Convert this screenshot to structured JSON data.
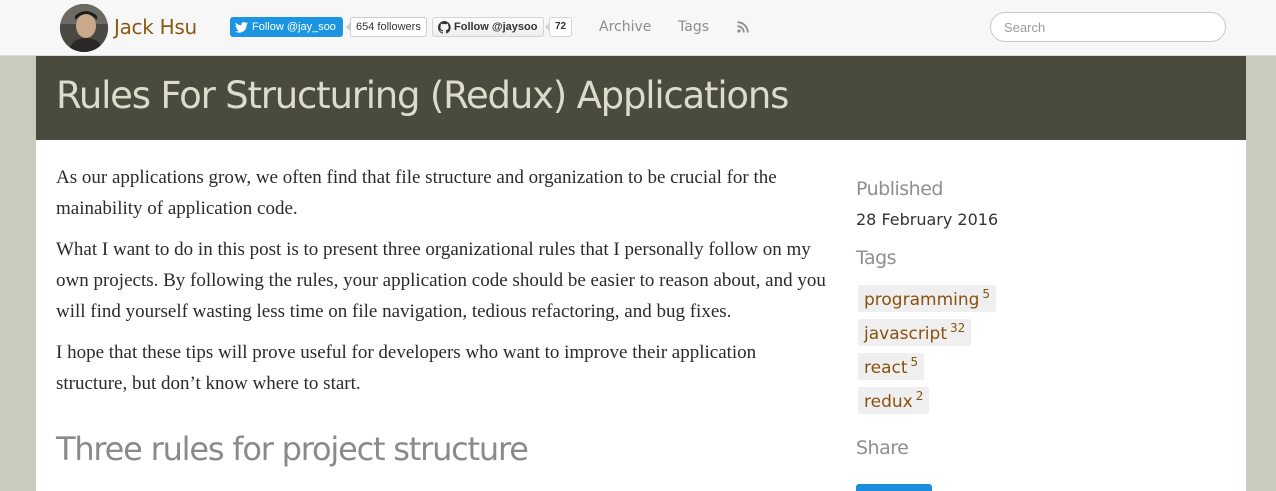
{
  "header": {
    "site_title": "Jack Hsu",
    "twitter_follow": "Follow @jay_soo",
    "twitter_count": "654 followers",
    "github_follow": "Follow @jaysoo",
    "github_count": "72",
    "nav": {
      "archive": "Archive",
      "tags": "Tags"
    },
    "search_placeholder": "Search"
  },
  "post": {
    "title": "Rules For Structuring (Redux) Applications",
    "paragraphs": [
      "As our applications grow, we often find that file structure and organization to be crucial for the mainability of application code.",
      "What I want to do in this post is to present three organizational rules that I personally follow on my own projects. By following the rules, your application code should be easier to reason about, and you will find yourself wasting less time on file navigation, tedious refactoring, and bug fixes.",
      "I hope that these tips will prove useful for developers who want to improve their application structure, but don’t know where to start."
    ],
    "section_heading": "Three rules for project structure"
  },
  "sidebar": {
    "published_heading": "Published",
    "published_date": "28 February 2016",
    "tags_heading": "Tags",
    "tags": [
      {
        "name": "programming",
        "count": "5"
      },
      {
        "name": "javascript",
        "count": "32"
      },
      {
        "name": "react",
        "count": "5"
      },
      {
        "name": "redux",
        "count": "2"
      }
    ],
    "share_heading": "Share"
  },
  "colors": {
    "background": "#c9ccbd",
    "title_band": "#4b4a3e",
    "link": "#8a5010",
    "twitter_blue": "#1b95e0"
  },
  "icons": [
    "twitter-bird-icon",
    "github-octocat-icon",
    "rss-icon"
  ]
}
